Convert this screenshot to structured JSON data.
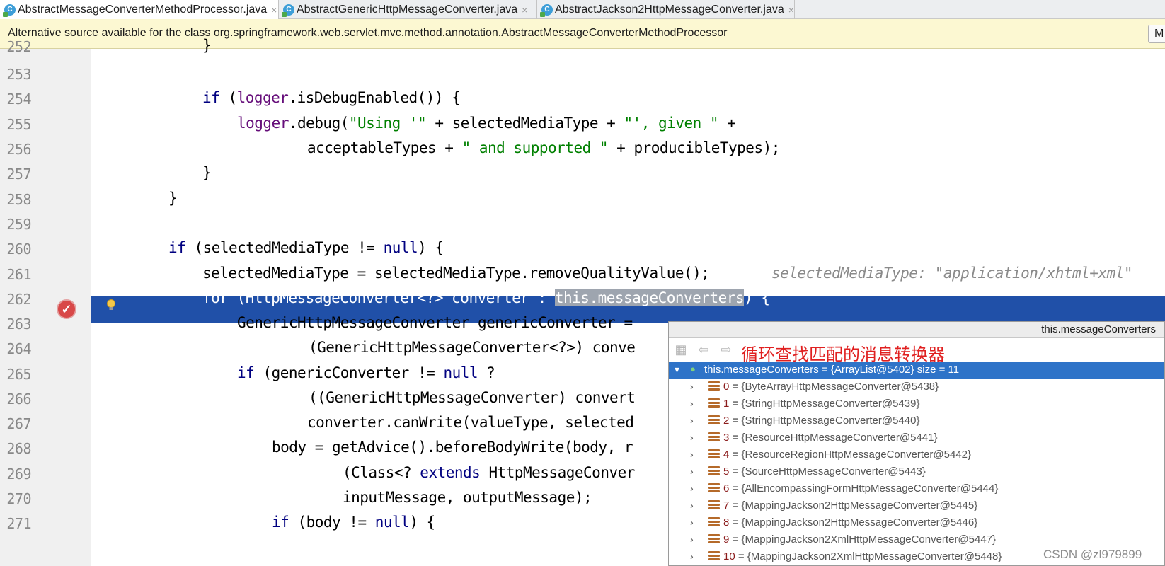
{
  "tabs": [
    {
      "label": "AbstractMessageConverterMethodProcessor.java",
      "active": true
    },
    {
      "label": "AbstractGenericHttpMessageConverter.java",
      "active": false
    },
    {
      "label": "AbstractJackson2HttpMessageConverter.java",
      "active": false
    }
  ],
  "tab_close_glyph": "×",
  "notice": {
    "text": "Alternative source available for the class org.springframework.web.servlet.mvc.method.annotation.AbstractMessageConverterMethodProcessor",
    "button_label": "M"
  },
  "code": {
    "partial_top_line": "252",
    "line_numbers": [
      "253",
      "254",
      "255",
      "256",
      "257",
      "258",
      "259",
      "260",
      "261",
      "262",
      "263",
      "264",
      "265",
      "266",
      "267",
      "268",
      "269",
      "270",
      "271"
    ],
    "tokens": {
      "l252_brace": "}",
      "l254_if": "if",
      "l254_open": " (",
      "l254_logger": "logger",
      "l254_rest": ".isDebugEnabled()) {",
      "l255_logger": "logger",
      "l255_debug": ".debug(",
      "l255_s1": "\"Using '\"",
      "l255_mid": " + selectedMediaType + ",
      "l255_s2": "\"', given \"",
      "l255_end": " +",
      "l256_a": "acceptableTypes + ",
      "l256_s": "\" and supported \"",
      "l256_b": " + producibleTypes);",
      "l257": "}",
      "l258": "}",
      "l260_if": "if",
      "l260_a": " (selectedMediaType != ",
      "l260_null": "null",
      "l260_b": ") {",
      "l261": "selectedMediaType = selectedMediaType.removeQualityValue();",
      "l261_hint": "selectedMediaType: \"application/xhtml+xml\"",
      "l262_for": "for",
      "l262_a": " (HttpMessageConverter<?> converter : ",
      "l262_sel": "this.messageConverters",
      "l262_b": ") {",
      "l263": "GenericHttpMessageConverter genericConverter =",
      "l264": "(GenericHttpMessageConverter<?>) conve",
      "l265_if": "if",
      "l265_a": " (genericConverter != ",
      "l265_null": "null",
      "l265_b": " ?",
      "l266": "((GenericHttpMessageConverter) convert",
      "l267": "converter.canWrite(valueType, selected",
      "l268": "body = getAdvice().beforeBodyWrite(body, r",
      "l269_a": "(Class<? ",
      "l269_ext": "extends",
      "l269_b": " HttpMessageConver",
      "l270": "inputMessage, outputMessage);",
      "l271_if": "if",
      "l271_a": " (body != ",
      "l271_null": "null",
      "l271_b": ") {"
    }
  },
  "popup": {
    "title": "this.messageConverters",
    "annotation": "循环查找匹配的消息转换器",
    "root_label": "this.messageConverters = {ArrayList@5402}  size = 11",
    "items": [
      {
        "index": "0",
        "value": "{ByteArrayHttpMessageConverter@5438}"
      },
      {
        "index": "1",
        "value": "{StringHttpMessageConverter@5439}"
      },
      {
        "index": "2",
        "value": "{StringHttpMessageConverter@5440}"
      },
      {
        "index": "3",
        "value": "{ResourceHttpMessageConverter@5441}"
      },
      {
        "index": "4",
        "value": "{ResourceRegionHttpMessageConverter@5442}"
      },
      {
        "index": "5",
        "value": "{SourceHttpMessageConverter@5443}"
      },
      {
        "index": "6",
        "value": "{AllEncompassingFormHttpMessageConverter@5444}"
      },
      {
        "index": "7",
        "value": "{MappingJackson2HttpMessageConverter@5445}"
      },
      {
        "index": "8",
        "value": "{MappingJackson2HttpMessageConverter@5446}"
      },
      {
        "index": "9",
        "value": "{MappingJackson2XmlHttpMessageConverter@5447}"
      },
      {
        "index": "10",
        "value": "{MappingJackson2XmlHttpMessageConverter@5448}"
      }
    ],
    "eq": " = "
  },
  "watermark": "CSDN @zl979899",
  "colors": {
    "execution_line": "#2050a8",
    "keyword": "#000080",
    "string": "#008000",
    "field": "#660e7a",
    "annotation": "#e02020",
    "tree_selected": "#2e73c8"
  },
  "icons": [
    "java-class-icon",
    "breakpoint-check-icon",
    "lightbulb-icon",
    "chevron-right-icon",
    "chevron-down-icon",
    "list-entry-icon",
    "back-arrow-icon",
    "forward-arrow-icon",
    "tree-view-icon"
  ]
}
